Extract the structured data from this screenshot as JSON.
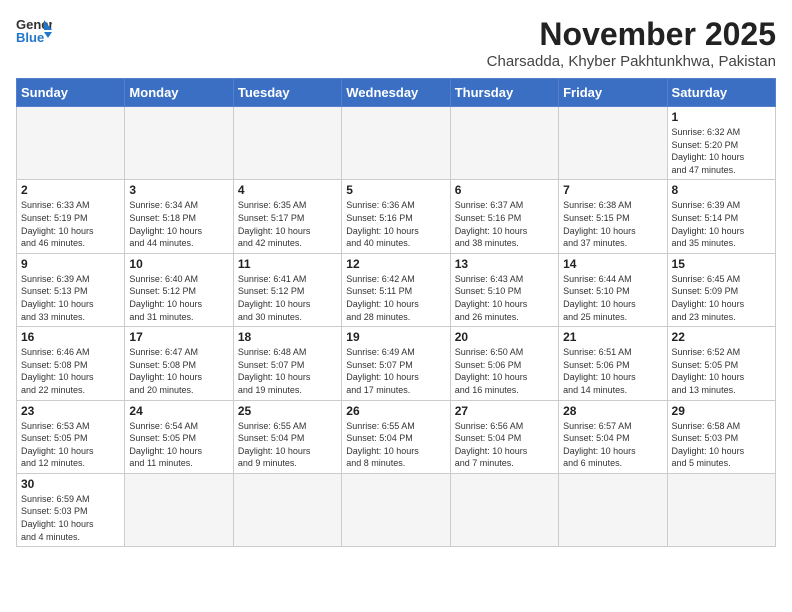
{
  "header": {
    "logo_general": "General",
    "logo_blue": "Blue",
    "month_title": "November 2025",
    "location": "Charsadda, Khyber Pakhtunkhwa, Pakistan"
  },
  "weekdays": [
    "Sunday",
    "Monday",
    "Tuesday",
    "Wednesday",
    "Thursday",
    "Friday",
    "Saturday"
  ],
  "days": [
    {
      "num": "",
      "info": ""
    },
    {
      "num": "",
      "info": ""
    },
    {
      "num": "",
      "info": ""
    },
    {
      "num": "",
      "info": ""
    },
    {
      "num": "",
      "info": ""
    },
    {
      "num": "",
      "info": ""
    },
    {
      "num": "1",
      "info": "Sunrise: 6:32 AM\nSunset: 5:20 PM\nDaylight: 10 hours\nand 47 minutes."
    },
    {
      "num": "2",
      "info": "Sunrise: 6:33 AM\nSunset: 5:19 PM\nDaylight: 10 hours\nand 46 minutes."
    },
    {
      "num": "3",
      "info": "Sunrise: 6:34 AM\nSunset: 5:18 PM\nDaylight: 10 hours\nand 44 minutes."
    },
    {
      "num": "4",
      "info": "Sunrise: 6:35 AM\nSunset: 5:17 PM\nDaylight: 10 hours\nand 42 minutes."
    },
    {
      "num": "5",
      "info": "Sunrise: 6:36 AM\nSunset: 5:16 PM\nDaylight: 10 hours\nand 40 minutes."
    },
    {
      "num": "6",
      "info": "Sunrise: 6:37 AM\nSunset: 5:16 PM\nDaylight: 10 hours\nand 38 minutes."
    },
    {
      "num": "7",
      "info": "Sunrise: 6:38 AM\nSunset: 5:15 PM\nDaylight: 10 hours\nand 37 minutes."
    },
    {
      "num": "8",
      "info": "Sunrise: 6:39 AM\nSunset: 5:14 PM\nDaylight: 10 hours\nand 35 minutes."
    },
    {
      "num": "9",
      "info": "Sunrise: 6:39 AM\nSunset: 5:13 PM\nDaylight: 10 hours\nand 33 minutes."
    },
    {
      "num": "10",
      "info": "Sunrise: 6:40 AM\nSunset: 5:12 PM\nDaylight: 10 hours\nand 31 minutes."
    },
    {
      "num": "11",
      "info": "Sunrise: 6:41 AM\nSunset: 5:12 PM\nDaylight: 10 hours\nand 30 minutes."
    },
    {
      "num": "12",
      "info": "Sunrise: 6:42 AM\nSunset: 5:11 PM\nDaylight: 10 hours\nand 28 minutes."
    },
    {
      "num": "13",
      "info": "Sunrise: 6:43 AM\nSunset: 5:10 PM\nDaylight: 10 hours\nand 26 minutes."
    },
    {
      "num": "14",
      "info": "Sunrise: 6:44 AM\nSunset: 5:10 PM\nDaylight: 10 hours\nand 25 minutes."
    },
    {
      "num": "15",
      "info": "Sunrise: 6:45 AM\nSunset: 5:09 PM\nDaylight: 10 hours\nand 23 minutes."
    },
    {
      "num": "16",
      "info": "Sunrise: 6:46 AM\nSunset: 5:08 PM\nDaylight: 10 hours\nand 22 minutes."
    },
    {
      "num": "17",
      "info": "Sunrise: 6:47 AM\nSunset: 5:08 PM\nDaylight: 10 hours\nand 20 minutes."
    },
    {
      "num": "18",
      "info": "Sunrise: 6:48 AM\nSunset: 5:07 PM\nDaylight: 10 hours\nand 19 minutes."
    },
    {
      "num": "19",
      "info": "Sunrise: 6:49 AM\nSunset: 5:07 PM\nDaylight: 10 hours\nand 17 minutes."
    },
    {
      "num": "20",
      "info": "Sunrise: 6:50 AM\nSunset: 5:06 PM\nDaylight: 10 hours\nand 16 minutes."
    },
    {
      "num": "21",
      "info": "Sunrise: 6:51 AM\nSunset: 5:06 PM\nDaylight: 10 hours\nand 14 minutes."
    },
    {
      "num": "22",
      "info": "Sunrise: 6:52 AM\nSunset: 5:05 PM\nDaylight: 10 hours\nand 13 minutes."
    },
    {
      "num": "23",
      "info": "Sunrise: 6:53 AM\nSunset: 5:05 PM\nDaylight: 10 hours\nand 12 minutes."
    },
    {
      "num": "24",
      "info": "Sunrise: 6:54 AM\nSunset: 5:05 PM\nDaylight: 10 hours\nand 11 minutes."
    },
    {
      "num": "25",
      "info": "Sunrise: 6:55 AM\nSunset: 5:04 PM\nDaylight: 10 hours\nand 9 minutes."
    },
    {
      "num": "26",
      "info": "Sunrise: 6:55 AM\nSunset: 5:04 PM\nDaylight: 10 hours\nand 8 minutes."
    },
    {
      "num": "27",
      "info": "Sunrise: 6:56 AM\nSunset: 5:04 PM\nDaylight: 10 hours\nand 7 minutes."
    },
    {
      "num": "28",
      "info": "Sunrise: 6:57 AM\nSunset: 5:04 PM\nDaylight: 10 hours\nand 6 minutes."
    },
    {
      "num": "29",
      "info": "Sunrise: 6:58 AM\nSunset: 5:03 PM\nDaylight: 10 hours\nand 5 minutes."
    },
    {
      "num": "30",
      "info": "Sunrise: 6:59 AM\nSunset: 5:03 PM\nDaylight: 10 hours\nand 4 minutes."
    }
  ]
}
